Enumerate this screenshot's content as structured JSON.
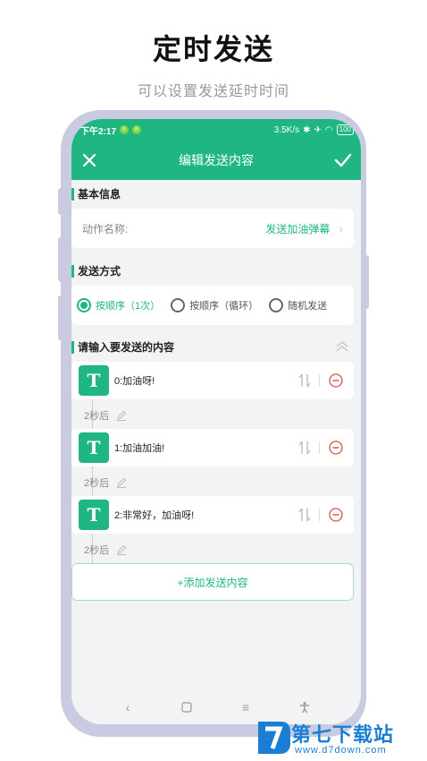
{
  "hero": {
    "title": "定时发送",
    "subtitle": "可以设置发送延时时间"
  },
  "statusbar": {
    "time": "下午2:17",
    "speed": "3.5K/s",
    "battery": "100"
  },
  "appbar": {
    "title": "编辑发送内容"
  },
  "basic": {
    "section": "基本信息",
    "label": "动作名称:",
    "value": "发送加油弹幕"
  },
  "mode": {
    "section": "发送方式",
    "options": [
      "按顺序（1次）",
      "按顺序（循环）",
      "随机发送"
    ],
    "selected": 0
  },
  "content": {
    "section": "请输入要发送的内容",
    "items": [
      {
        "text": "0:加油呀!",
        "delay": "2秒后"
      },
      {
        "text": "1:加油加油!",
        "delay": "2秒后"
      },
      {
        "text": "2:非常好，加油呀!",
        "delay": "2秒后"
      }
    ],
    "badge": "T",
    "add_label": "+添加发送内容"
  },
  "watermark": {
    "name": "第七下载站",
    "url": "www.d7down.com"
  },
  "colors": {
    "accent": "#20b682",
    "danger": "#d9534f",
    "frame": "#c9cce0"
  }
}
